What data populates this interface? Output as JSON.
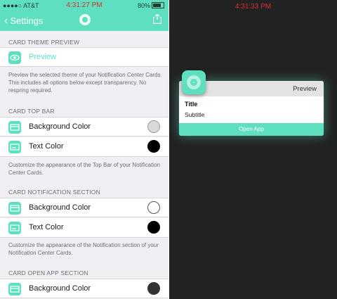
{
  "status": {
    "carrier": "●●●●○ AT&T",
    "time": "4:31:27 PM",
    "battery": "80%"
  },
  "nav": {
    "back_label": "Settings"
  },
  "sections": {
    "theme": {
      "header": "CARD THEME PREVIEW",
      "preview_label": "Preview",
      "note": "Preview the selected theme of your Notification Center Cards. This includes all options below except transparency. No respring required."
    },
    "top_bar": {
      "header": "CARD TOP BAR",
      "bg_label": "Background Color",
      "text_label": "Text Color",
      "note": "Customize the appearance of the Top Bar of your Notification Center Cards."
    },
    "notification": {
      "header": "CARD NOTIFICATION SECTION",
      "bg_label": "Background Color",
      "text_label": "Text Color",
      "note": "Customize the appearance of the Notification section of your Notification Center Cards."
    },
    "open_app": {
      "header": "CARD OPEN APP SECTION",
      "bg_label": "Background Color"
    }
  },
  "swatches": {
    "top_bar_bg": "#d9d9d9",
    "top_bar_text": "#000000",
    "notif_bg": "#ffffff",
    "notif_text": "#000000",
    "open_app_bg": "#333333"
  },
  "preview_screen": {
    "time": "4:31:33 PM",
    "card_header": "Preview",
    "title": "Title",
    "subtitle": "Subtitle",
    "button": "Open App"
  },
  "colors": {
    "accent": "#5ee0c0",
    "time_red": "#d9302b"
  }
}
